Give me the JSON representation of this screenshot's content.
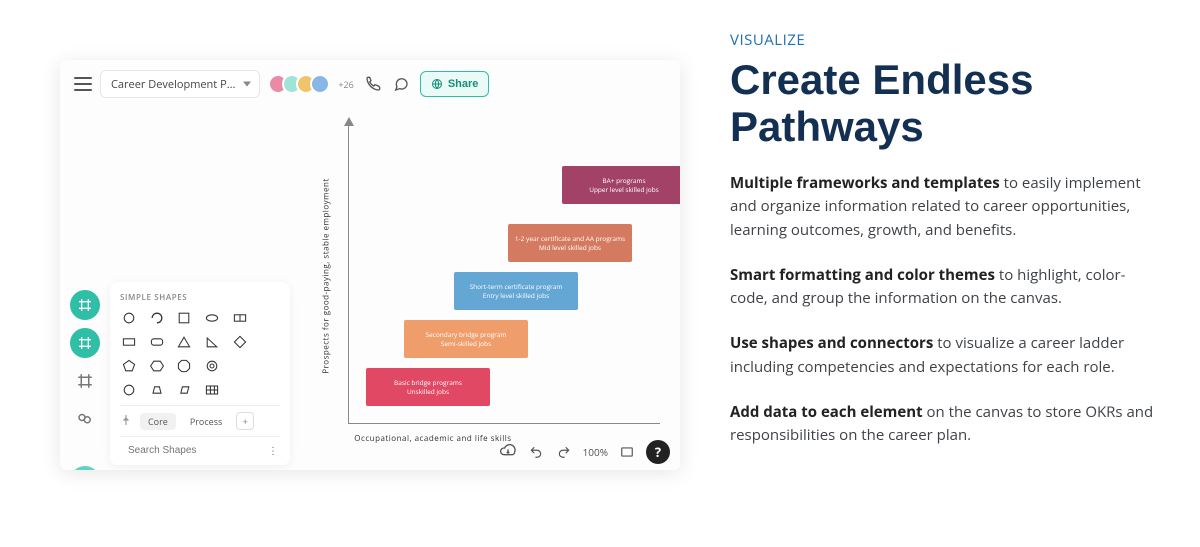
{
  "topbar": {
    "file_name": "Career Development P...",
    "avatar_overflow": "+26",
    "share_label": "Share"
  },
  "canvas": {
    "y_axis_label": "Prospects   for   good-paying,   stable   employment",
    "x_axis_label": "Occupational,    academic    and    life   skills",
    "steps": {
      "s1_l1": "Basic  bridge  programs",
      "s1_l2": "Unskilled  jobs",
      "s2_l1": "Secondary  bridge  program",
      "s2_l2": "Semi-skilled  jobs",
      "s3_l1": "Short-term  certificate  program",
      "s3_l2": "Entry  level  skilled  jobs",
      "s4_l1": "1-2  year  certificate  and  AA  programs",
      "s4_l2": "Mid  level  skilled  jobs",
      "s5_l1": "BA+  programs",
      "s5_l2": "Upper  level  skilled  jobs"
    }
  },
  "bottombar": {
    "zoom": "100%"
  },
  "panel": {
    "title": "SIMPLE SHAPES",
    "tab_core": "Core",
    "tab_process": "Process",
    "search_placeholder": "Search Shapes"
  },
  "marketing": {
    "eyebrow": "VISUALIZE",
    "heading": "Create Endless Pathways",
    "p1b": "Multiple frameworks and templates",
    "p1": " to easily implement and organize information related to career opportunities, learning outcomes, growth, and benefits.",
    "p2b": "Smart formatting and color themes",
    "p2": " to highlight, color-code, and group the information on the canvas.",
    "p3b": "Use shapes and connectors",
    "p3": " to visualize a career ladder including competencies and expectations for each role.",
    "p4b": "Add data to each element",
    "p4": " on the canvas to store OKRs and responsibilities on the career plan."
  }
}
